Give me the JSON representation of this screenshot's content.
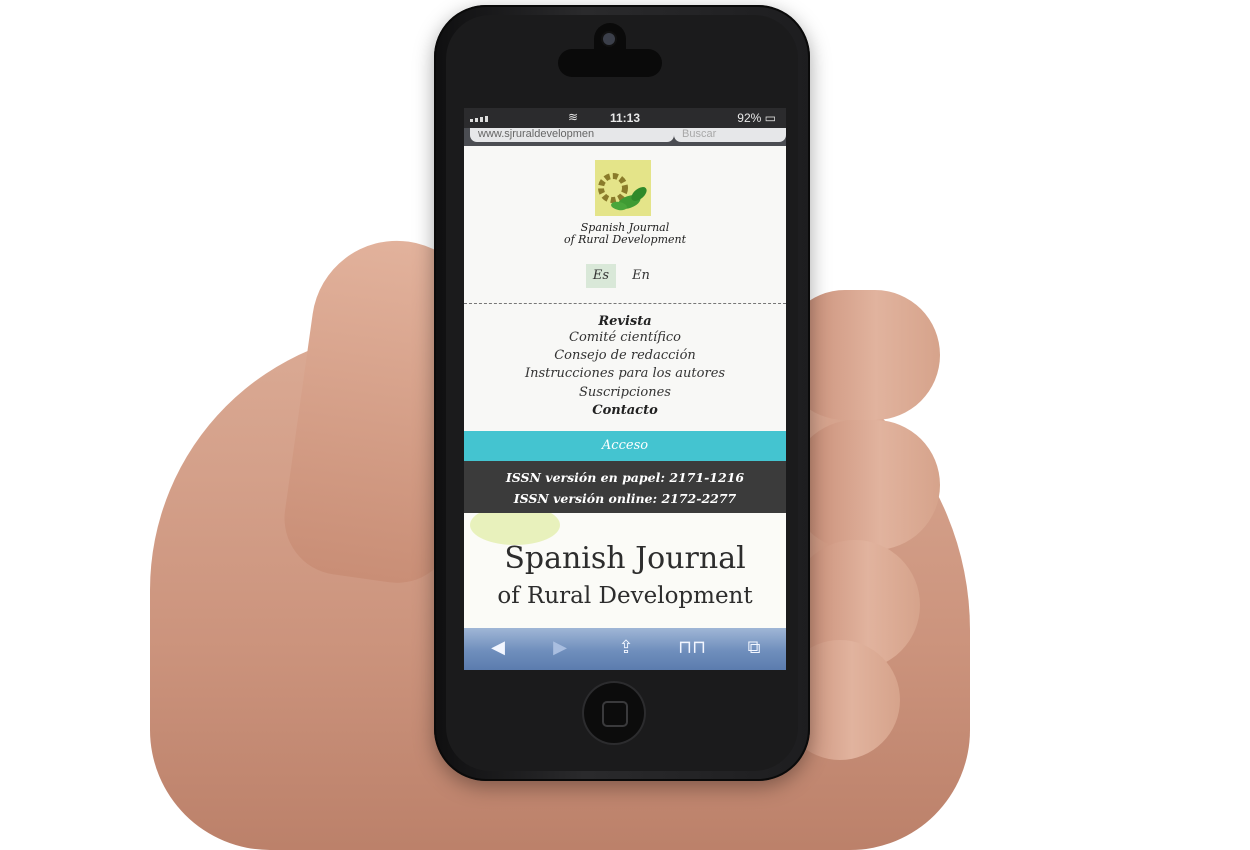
{
  "status_bar": {
    "time": "11:13",
    "battery": "92%"
  },
  "browser": {
    "url": "www.sjruraldevelopmen",
    "search_placeholder": "Buscar"
  },
  "site": {
    "brand_line1": "Spanish Journal",
    "brand_line2": "of Rural Development",
    "languages": {
      "es": "Es",
      "en": "En"
    },
    "nav": {
      "revista": "Revista",
      "comite": "Comité científico",
      "consejo": "Consejo de redacción",
      "instrucciones": "Instrucciones para los autores",
      "suscripciones": "Suscripciones",
      "contacto": "Contacto"
    },
    "acceso": "Acceso",
    "issn_paper": "ISSN versión en papel: 2171-1216",
    "issn_online": "ISSN versión online: 2172-2277",
    "hero_title1": "Spanish Journal",
    "hero_title2": "of Rural Development"
  },
  "toolbar_icons": [
    "back-icon",
    "forward-icon",
    "share-icon",
    "bookmarks-icon",
    "tabs-icon"
  ],
  "colors": {
    "accent": "#44c4d0",
    "issn_bar": "#3b3b3b",
    "selected_lang": "#d9e8d8",
    "toolbar": "#6f8ebc"
  }
}
